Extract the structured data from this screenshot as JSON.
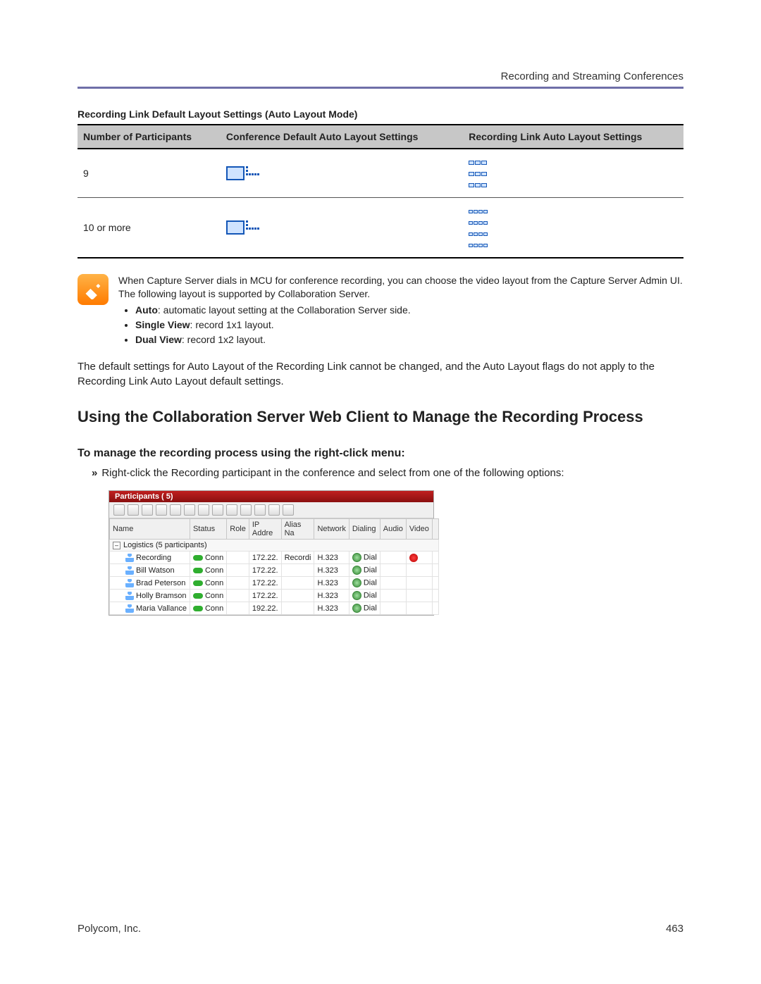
{
  "header": {
    "section_title": "Recording and Streaming Conferences"
  },
  "layout_table": {
    "title": "Recording Link Default Layout Settings (Auto Layout Mode)",
    "columns": [
      "Number of Participants",
      "Conference Default Auto Layout Settings",
      "Recording Link Auto Layout Settings"
    ],
    "rows": [
      {
        "participants": "9"
      },
      {
        "participants": "10 or more"
      }
    ]
  },
  "callout": {
    "intro": "When Capture Server dials in MCU for conference recording, you can choose the video layout from the Capture Server Admin UI. The following layout is supported by Collaboration Server.",
    "items": [
      {
        "term": "Auto",
        "desc": ": automatic layout setting at the Collaboration Server side."
      },
      {
        "term": "Single View",
        "desc": ": record 1x1 layout."
      },
      {
        "term": "Dual View",
        "desc": ": record 1x2 layout."
      }
    ]
  },
  "body_paragraph": "The default settings for Auto Layout of the Recording Link cannot be changed, and the Auto Layout flags do not apply to the Recording Link Auto Layout default settings.",
  "section_heading": "Using the Collaboration Server Web Client to Manage the Recording Process",
  "subsection_heading": "To manage the recording process using the right-click menu:",
  "instruction": {
    "marker": "»",
    "text": "Right-click the Recording participant in the conference and select from one of the following options:"
  },
  "participants_panel": {
    "title": "Participants ( 5)",
    "columns": [
      "Name",
      "Status",
      "Role",
      "IP Addre",
      "Alias Na",
      "Network",
      "Dialing",
      "Audio",
      "Video",
      ""
    ],
    "group_label": "Logistics (5  participants)",
    "rows": [
      {
        "name": "Recording",
        "status": "Conn",
        "ip": "172.22.",
        "alias": "Recordi",
        "network": "H.323",
        "dialing": "Dial",
        "video_rec": true
      },
      {
        "name": "Bill Watson",
        "status": "Conn",
        "ip": "172.22.",
        "alias": "",
        "network": "H.323",
        "dialing": "Dial",
        "video_rec": false
      },
      {
        "name": "Brad Peterson",
        "status": "Conn",
        "ip": "172.22.",
        "alias": "",
        "network": "H.323",
        "dialing": "Dial",
        "video_rec": false
      },
      {
        "name": "Holly Bramson",
        "status": "Conn",
        "ip": "172.22.",
        "alias": "",
        "network": "H.323",
        "dialing": "Dial",
        "video_rec": false
      },
      {
        "name": "Maria Vallance",
        "status": "Conn",
        "ip": "192.22.",
        "alias": "",
        "network": "H.323",
        "dialing": "Dial",
        "video_rec": false
      }
    ]
  },
  "footer": {
    "company": "Polycom, Inc.",
    "page": "463"
  }
}
